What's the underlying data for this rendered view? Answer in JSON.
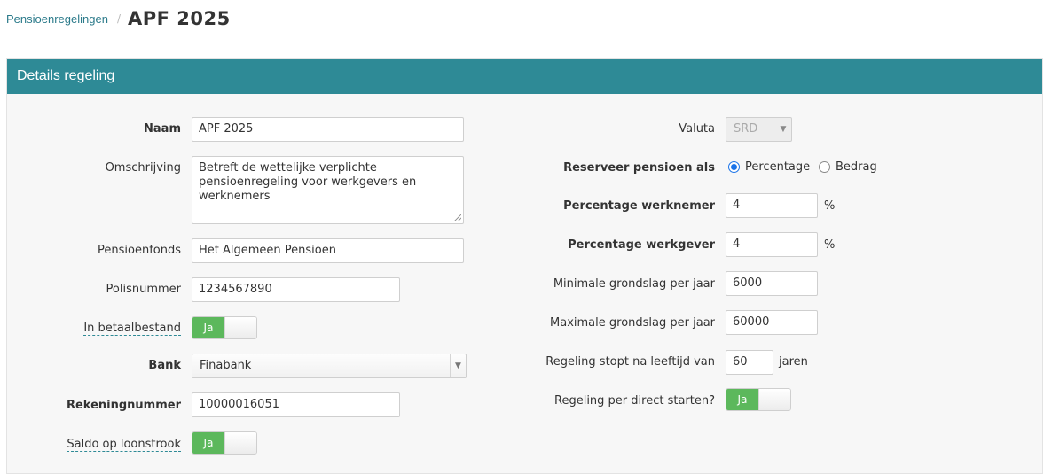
{
  "breadcrumb": {
    "parent": "Pensioenregelingen",
    "separator": "/",
    "current": "APF 2025"
  },
  "panel": {
    "title": "Details regeling"
  },
  "left": {
    "naam": {
      "label": "Naam",
      "value": "APF 2025"
    },
    "omschrijving": {
      "label": "Omschrijving",
      "value": "Betreft de wettelijke verplichte pensioenregeling voor werkgevers en werknemers"
    },
    "pensioenfonds": {
      "label": "Pensioenfonds",
      "value": "Het Algemeen Pensioen"
    },
    "polisnummer": {
      "label": "Polisnummer",
      "value": "1234567890"
    },
    "betaalbestand": {
      "label": "In betaalbestand",
      "toggle": "Ja"
    },
    "bank": {
      "label": "Bank",
      "value": "Finabank"
    },
    "rekeningnummer": {
      "label": "Rekeningnummer",
      "value": "10000016051"
    },
    "saldo": {
      "label": "Saldo op loonstrook",
      "toggle": "Ja"
    }
  },
  "right": {
    "valuta": {
      "label": "Valuta",
      "value": "SRD"
    },
    "reserveer": {
      "label": "Reserveer pensioen als",
      "option1": "Percentage",
      "option2": "Bedrag"
    },
    "perc_werknemer": {
      "label": "Percentage werknemer",
      "value": "4",
      "unit": "%"
    },
    "perc_werkgever": {
      "label": "Percentage werkgever",
      "value": "4",
      "unit": "%"
    },
    "min_grondslag": {
      "label": "Minimale grondslag per jaar",
      "value": "6000"
    },
    "max_grondslag": {
      "label": "Maximale grondslag per jaar",
      "value": "60000"
    },
    "stopt": {
      "label": "Regeling stopt na leeftijd van",
      "value": "60",
      "unit": "jaren"
    },
    "direct": {
      "label": "Regeling per direct starten?",
      "toggle": "Ja"
    }
  },
  "colors": {
    "header": "#2e8a96",
    "toggle_on": "#5cb85c",
    "link": "#2b7a8a"
  }
}
